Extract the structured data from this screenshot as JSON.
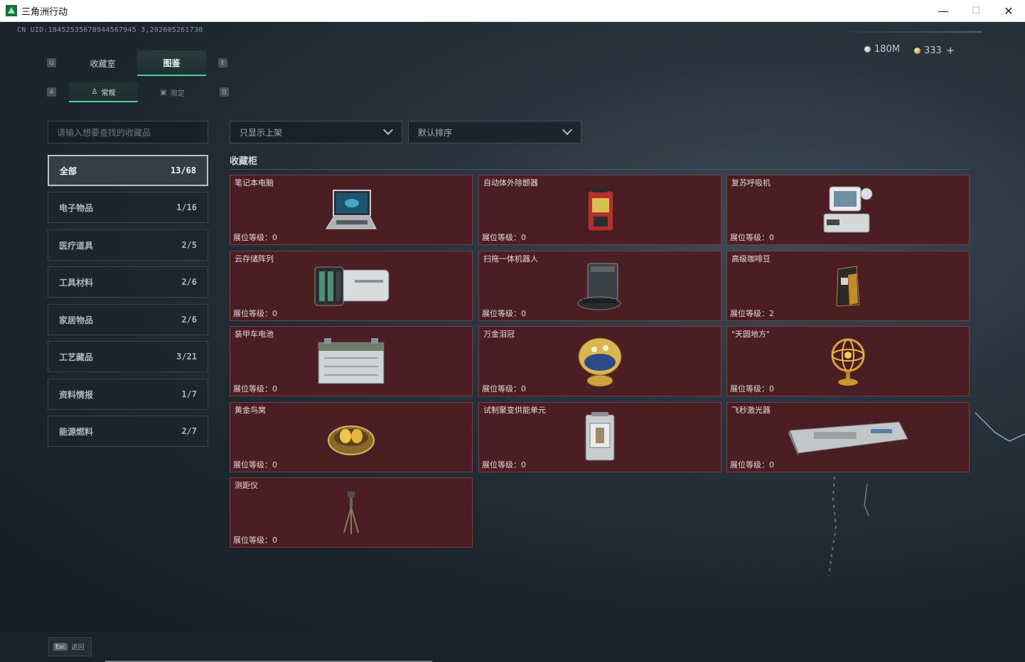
{
  "window": {
    "title": "三角洲行动",
    "minimize": "—",
    "maximize": "☐",
    "close": "✕"
  },
  "uid": "CN UID:18452535678944567945 3,202605261730",
  "currency": {
    "silver": "180M",
    "gold": "333",
    "add": "+"
  },
  "keys": {
    "tab_left": "Q",
    "tab_right": "E",
    "sub_left": "A",
    "sub_right": "D"
  },
  "tabs": [
    {
      "label": "收藏室"
    },
    {
      "label": "图鉴"
    }
  ],
  "subtabs": [
    {
      "label": "常规",
      "icon": "trophy-icon"
    },
    {
      "label": "限定",
      "icon": "image-icon"
    }
  ],
  "search": {
    "placeholder": "请输入想要查找的收藏品"
  },
  "categories": [
    {
      "label": "全部",
      "count": "13/68"
    },
    {
      "label": "电子物品",
      "count": "1/16"
    },
    {
      "label": "医疗道具",
      "count": "2/5"
    },
    {
      "label": "工具材料",
      "count": "2/6"
    },
    {
      "label": "家居物品",
      "count": "2/6"
    },
    {
      "label": "工艺藏品",
      "count": "3/21"
    },
    {
      "label": "资料情报",
      "count": "1/7"
    },
    {
      "label": "能源燃料",
      "count": "2/7"
    }
  ],
  "filters": {
    "shelf": "只显示上架",
    "sort": "默认排序"
  },
  "section_title": "收藏柜",
  "level_label": "展位等级：",
  "items": [
    {
      "name": "笔记本电脑",
      "level": "0",
      "icon": "laptop-icon"
    },
    {
      "name": "自动体外除颤器",
      "level": "0",
      "icon": "defibrillator-icon"
    },
    {
      "name": "复苏呼吸机",
      "level": "0",
      "icon": "ventilator-icon"
    },
    {
      "name": "云存储阵列",
      "level": "0",
      "icon": "storage-array-icon"
    },
    {
      "name": "扫拖一体机器人",
      "level": "0",
      "icon": "robot-vacuum-icon"
    },
    {
      "name": "高级咖啡豆",
      "level": "2",
      "icon": "coffee-bag-icon"
    },
    {
      "name": "装甲车电池",
      "level": "0",
      "icon": "battery-icon"
    },
    {
      "name": "万金泪冠",
      "level": "0",
      "icon": "jeweled-egg-icon"
    },
    {
      "name": "\"天圆地方\"",
      "level": "0",
      "icon": "armillary-sphere-icon"
    },
    {
      "name": "黄金鸟窝",
      "level": "0",
      "icon": "golden-nest-icon"
    },
    {
      "name": "试制聚变供能单元",
      "level": "0",
      "icon": "fusion-cell-icon"
    },
    {
      "name": "飞秒激光器",
      "level": "0",
      "icon": "laser-device-icon"
    },
    {
      "name": "测距仪",
      "level": "0",
      "icon": "rangefinder-tripod-icon"
    }
  ],
  "bottom": {
    "esc_key": "Esc",
    "esc_label": "返回"
  }
}
